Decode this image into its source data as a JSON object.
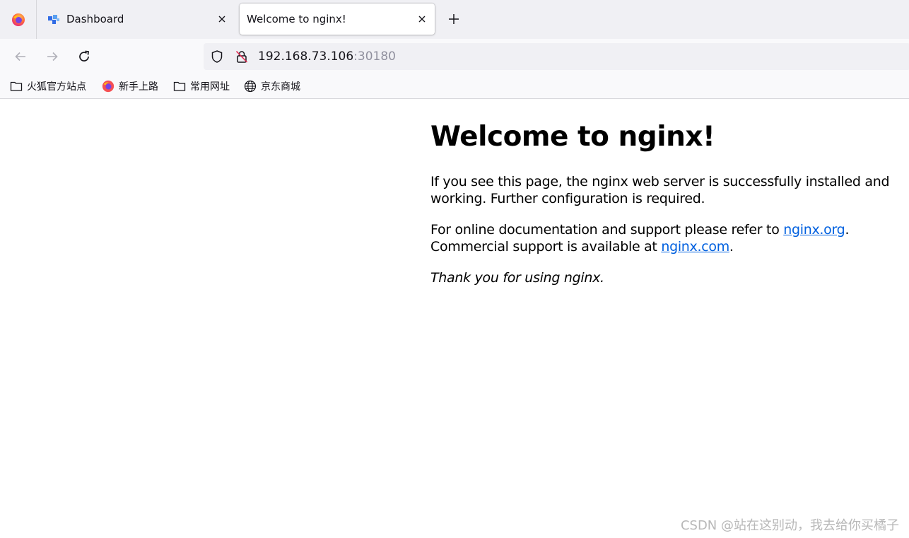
{
  "tabs": {
    "inactive": {
      "label": "Dashboard",
      "favicon": "kubernetes-dashboard-icon"
    },
    "active": {
      "label": "Welcome to nginx!"
    },
    "new_tab_icon": "plus-icon"
  },
  "navbar": {
    "url_host": "192.168.73.106",
    "url_port": ":30180"
  },
  "bookmarks": [
    {
      "label": "火狐官方站点",
      "icon": "folder-icon"
    },
    {
      "label": "新手上路",
      "icon": "firefox-icon"
    },
    {
      "label": "常用网址",
      "icon": "folder-icon"
    },
    {
      "label": "京东商城",
      "icon": "globe-icon"
    }
  ],
  "page": {
    "heading": "Welcome to nginx!",
    "p1": "If you see this page, the nginx web server is successfully installed and working. Further configuration is required.",
    "p2_prefix": "For online documentation and support please refer to ",
    "link_org": "nginx.org",
    "p2_mid": ".",
    "p2_line2": "Commercial support is available at ",
    "link_com": "nginx.com",
    "p2_end": ".",
    "p3": "Thank you for using nginx."
  },
  "watermark": "CSDN @站在这别动，我去给你买橘子",
  "colors": {
    "tabstrip_bg": "#f0f0f4",
    "toolbar_bg": "#f9f9fb",
    "link": "#0060df",
    "port_text": "#8f8f9d"
  }
}
